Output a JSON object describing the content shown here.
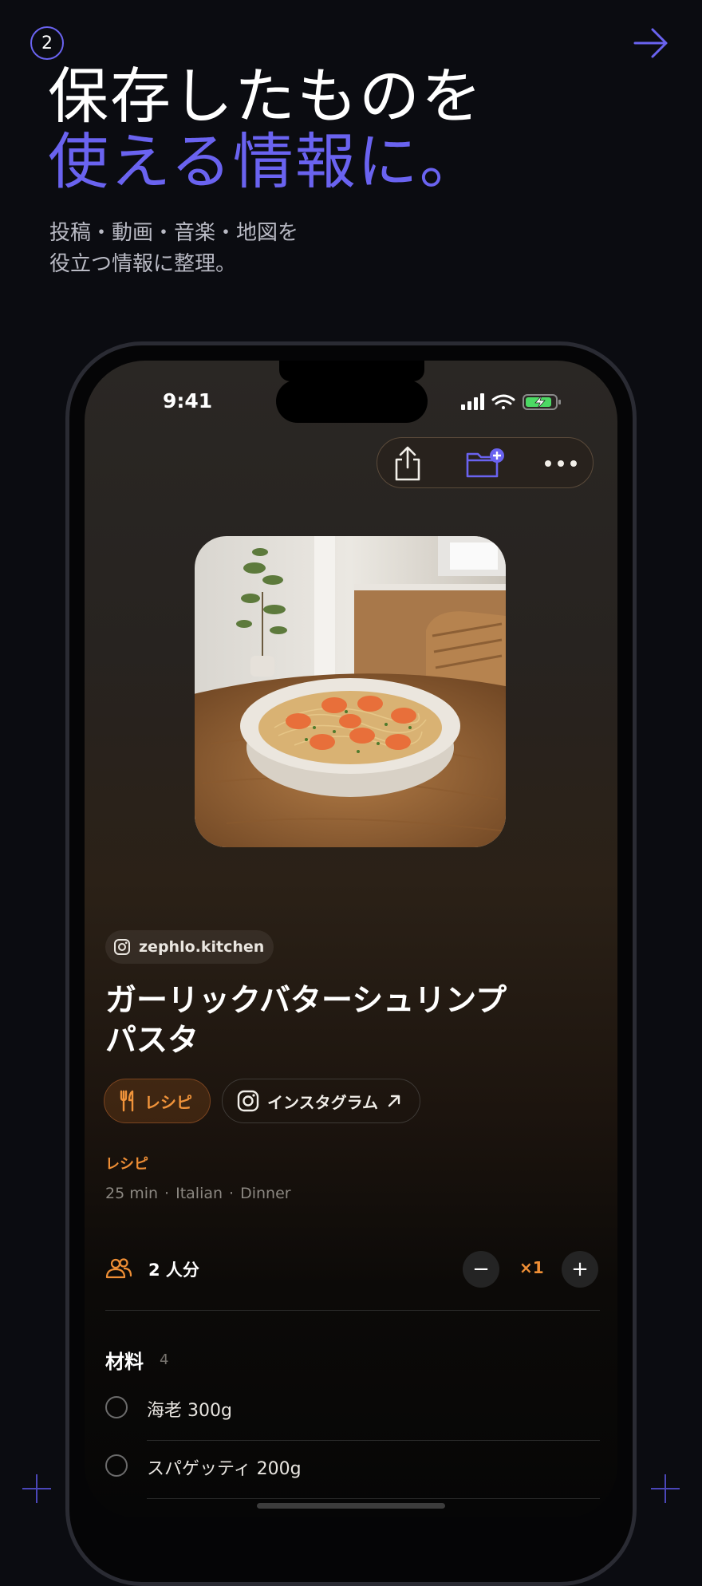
{
  "step": {
    "number": "2"
  },
  "headline": {
    "line1": "保存したものを",
    "line2": "使える情報に。"
  },
  "subtitle": {
    "line1": "投稿・動画・音楽・地図を",
    "line2": "役立つ情報に整理。"
  },
  "colors": {
    "accent": "#6a63f0",
    "orange": "#ee8e35",
    "background": "#0b0c11"
  },
  "status_bar": {
    "time": "9:41",
    "icons": [
      "signal-icon",
      "wifi-icon",
      "battery-charging-icon"
    ]
  },
  "actions": {
    "icons": [
      "share-icon",
      "folder-add-icon",
      "more-icon"
    ]
  },
  "source": {
    "icon": "instagram-icon",
    "handle": "zephlo.kitchen"
  },
  "recipe": {
    "title_line1": "ガーリックバターシュリンプ",
    "title_line2": "パスタ",
    "tags": [
      {
        "icon": "fork-knife-icon",
        "label": "レシピ"
      },
      {
        "icon": "instagram-icon",
        "label": "インスタグラム",
        "trailing_icon": "arrow-up-right-icon"
      }
    ],
    "category": "レシピ",
    "meta": {
      "time": "25 min",
      "cuisine": "Italian",
      "meal": "Dinner"
    },
    "servings": {
      "icon": "people-icon",
      "label": "2 人分",
      "decrement": "−",
      "multiplier": "×1",
      "increment": "+"
    },
    "ingredients": {
      "title": "材料",
      "count": "4",
      "items": [
        "海老 300g",
        "スパゲッティ 200g"
      ]
    }
  }
}
